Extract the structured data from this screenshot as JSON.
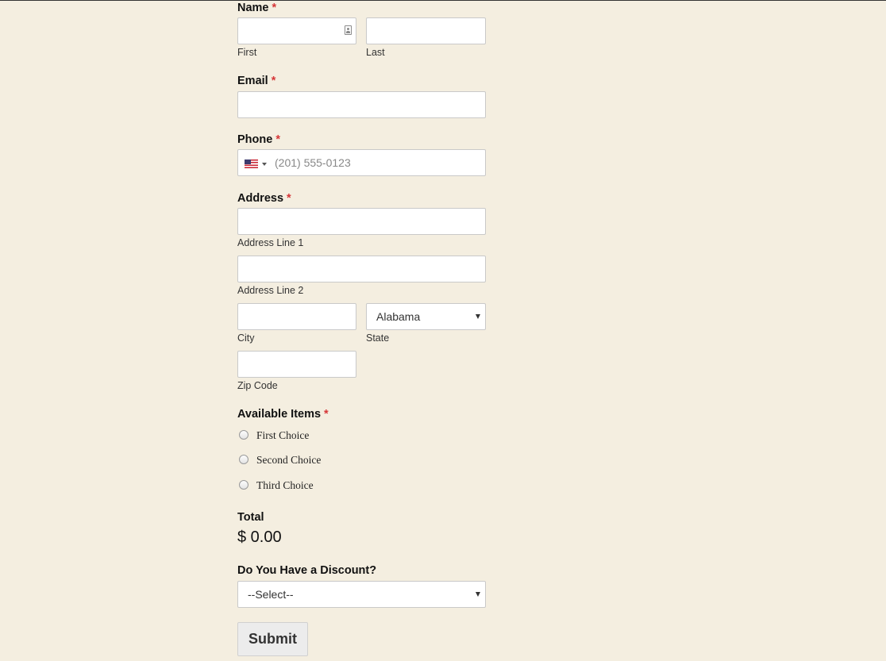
{
  "name": {
    "label": "Name",
    "required_marker": "*",
    "first_sublabel": "First",
    "last_sublabel": "Last",
    "first_value": "",
    "last_value": ""
  },
  "email": {
    "label": "Email",
    "required_marker": "*",
    "value": ""
  },
  "phone": {
    "label": "Phone",
    "required_marker": "*",
    "placeholder": "(201) 555-0123",
    "country_flag": "us-flag-icon",
    "value": ""
  },
  "address": {
    "label": "Address",
    "required_marker": "*",
    "line1_sublabel": "Address Line 1",
    "line2_sublabel": "Address Line 2",
    "city_sublabel": "City",
    "state_sublabel": "State",
    "state_selected": "Alabama",
    "zip_sublabel": "Zip Code"
  },
  "items": {
    "label": "Available Items",
    "required_marker": "*",
    "options": [
      {
        "label": "First Choice",
        "selected": false
      },
      {
        "label": "Second Choice",
        "selected": false
      },
      {
        "label": "Third Choice",
        "selected": false
      }
    ]
  },
  "total": {
    "label": "Total",
    "value": "$ 0.00"
  },
  "discount": {
    "label": "Do You Have a Discount?",
    "selected": "--Select--"
  },
  "submit": {
    "label": "Submit"
  },
  "colors": {
    "background": "#f4eee0",
    "required": "#d63638",
    "input_border": "#c9c9c9"
  }
}
